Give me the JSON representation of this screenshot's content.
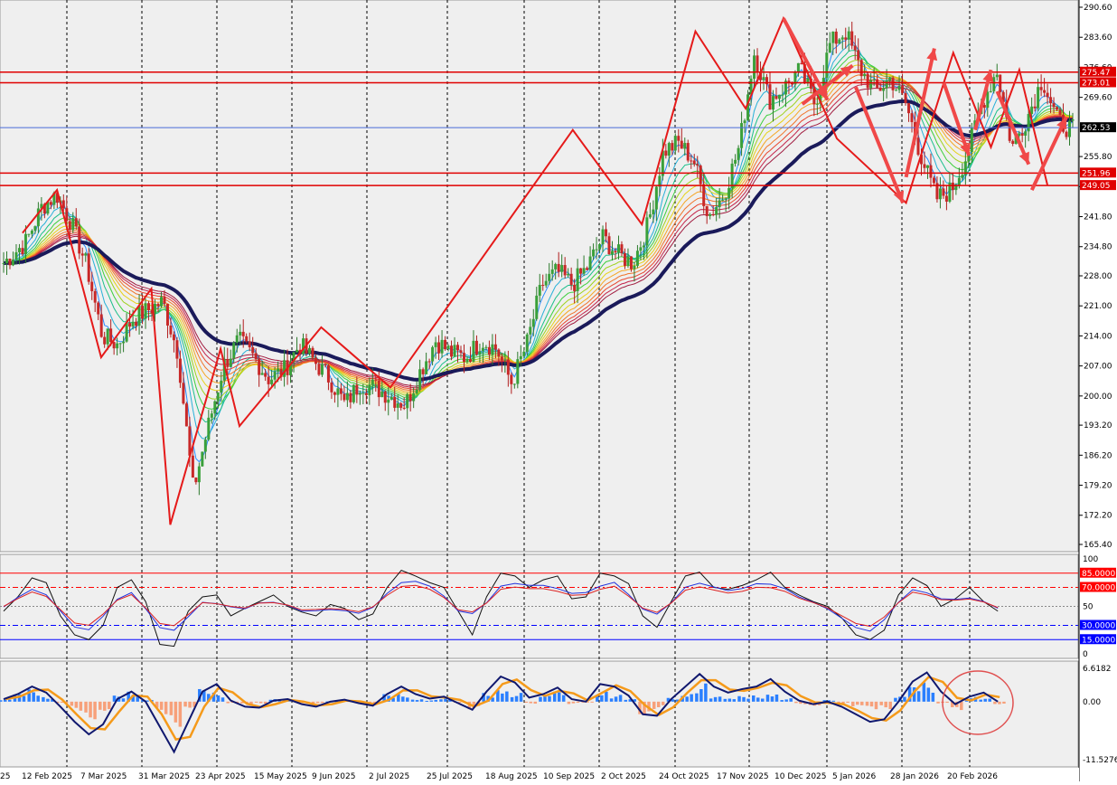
{
  "chart_data": [
    {
      "panel": "price",
      "type": "line",
      "title": "",
      "ylim": [
        165.4,
        290.6
      ],
      "y_ticks": [
        "290.60",
        "283.60",
        "276.60",
        "269.60",
        "262.53",
        "255.80",
        "248.80",
        "241.80",
        "234.80",
        "228.00",
        "221.00",
        "214.00",
        "207.00",
        "200.00",
        "193.20",
        "186.20",
        "179.20",
        "172.20",
        "165.40"
      ],
      "x_ticks": [
        "25",
        "12 Feb 2025",
        "7 Mar 2025",
        "31 Mar 2025",
        "23 Apr 2025",
        "15 May 2025",
        "9 Jun 2025",
        "2 Jul 2025",
        "25 Jul 2025",
        "18 Aug 2025",
        "10 Sep 2025",
        "2 Oct 2025",
        "24 Oct 2025",
        "17 Nov 2025",
        "10 Dec 2025",
        "5 Jan 2026",
        "28 Jan 2026",
        "20 Feb 2026"
      ],
      "current_price": "262.53",
      "horizontal_levels": [
        {
          "label": "275.47",
          "value": 275.47
        },
        {
          "label": "273.01",
          "value": 273.01
        },
        {
          "label": "251.96",
          "value": 251.96
        },
        {
          "label": "249.05",
          "value": 249.05
        }
      ],
      "close_series_index": [
        0,
        6,
        10,
        14,
        18,
        22,
        26,
        30,
        34,
        38,
        42,
        46,
        50,
        54,
        58,
        62,
        66,
        70,
        74,
        78,
        82,
        86,
        90,
        94,
        98,
        102,
        106,
        110,
        114,
        118,
        122,
        126,
        130,
        134,
        138,
        142,
        146,
        150,
        154,
        158,
        162,
        166,
        170,
        174,
        178,
        182,
        186,
        190,
        194,
        198,
        202,
        206,
        210,
        214,
        218,
        222,
        226,
        230,
        234,
        238,
        242,
        246,
        250,
        254,
        258,
        262,
        266,
        270,
        274,
        278,
        282
      ],
      "close_series_values": [
        231,
        236,
        244,
        247,
        240,
        230,
        214,
        212,
        218,
        220,
        222,
        210,
        178,
        193,
        207,
        213,
        209,
        204,
        206,
        212,
        208,
        204,
        198,
        203,
        202,
        200,
        198,
        206,
        213,
        210,
        209,
        213,
        211,
        203,
        212,
        226,
        229,
        226,
        230,
        237,
        233,
        231,
        240,
        257,
        259,
        255,
        242,
        247,
        258,
        280,
        269,
        272,
        276,
        268,
        282,
        285,
        276,
        271,
        274,
        268,
        256,
        246,
        248,
        256,
        268,
        276,
        258,
        265,
        274,
        264,
        262
      ],
      "zigzag_pivots": [
        {
          "x": 6,
          "y": 238
        },
        {
          "x": 17,
          "y": 248
        },
        {
          "x": 31,
          "y": 209
        },
        {
          "x": 47,
          "y": 225
        },
        {
          "x": 53,
          "y": 170
        },
        {
          "x": 69,
          "y": 211
        },
        {
          "x": 75,
          "y": 193
        },
        {
          "x": 101,
          "y": 216
        },
        {
          "x": 123,
          "y": 202
        },
        {
          "x": 181,
          "y": 262
        },
        {
          "x": 203,
          "y": 240
        },
        {
          "x": 220,
          "y": 285
        },
        {
          "x": 236,
          "y": 267
        },
        {
          "x": 248,
          "y": 288
        },
        {
          "x": 265,
          "y": 260
        },
        {
          "x": 287,
          "y": 245
        },
        {
          "x": 302,
          "y": 280
        },
        {
          "x": 314,
          "y": 258
        },
        {
          "x": 323,
          "y": 276
        },
        {
          "x": 332,
          "y": 249
        }
      ],
      "forecast_arrows": [
        {
          "from": [
            248,
            288
          ],
          "to": [
            262,
            269
          ]
        },
        {
          "from": [
            254,
            268
          ],
          "to": [
            270,
            277
          ]
        },
        {
          "from": [
            271,
            272
          ],
          "to": [
            286,
            245
          ]
        },
        {
          "from": [
            287,
            251
          ],
          "to": [
            296,
            281
          ]
        },
        {
          "from": [
            299,
            273
          ],
          "to": [
            307,
            256
          ]
        },
        {
          "from": [
            309,
            262
          ],
          "to": [
            314,
            276
          ]
        },
        {
          "from": [
            316,
            271
          ],
          "to": [
            326,
            254
          ]
        },
        {
          "from": [
            327,
            248
          ],
          "to": [
            338,
            265
          ]
        }
      ]
    },
    {
      "panel": "stochastic",
      "type": "line",
      "ylim": [
        0,
        100
      ],
      "y_ticks": [
        "100",
        "50",
        "0"
      ],
      "levels": [
        {
          "label": "85.0000",
          "value": 85,
          "color": "#ff0000"
        },
        {
          "label": "70.0000",
          "value": 70,
          "color": "#ff0000"
        },
        {
          "label": "30.0000",
          "value": 30,
          "color": "#0000ff"
        },
        {
          "label": "15.0000",
          "value": 15,
          "color": "#0000ff"
        }
      ],
      "k_values": [
        45,
        60,
        80,
        75,
        40,
        20,
        15,
        30,
        70,
        78,
        55,
        10,
        8,
        45,
        60,
        62,
        40,
        48,
        55,
        62,
        50,
        44,
        40,
        52,
        48,
        36,
        42,
        70,
        88,
        82,
        75,
        70,
        45,
        20,
        60,
        85,
        82,
        70,
        78,
        82,
        58,
        60,
        85,
        82,
        74,
        40,
        28,
        55,
        82,
        86,
        70,
        68,
        72,
        78,
        86,
        70,
        62,
        55,
        50,
        38,
        20,
        15,
        25,
        62,
        80,
        72,
        50,
        58,
        70,
        55,
        45
      ]
    },
    {
      "panel": "macd",
      "type": "bar",
      "ylim": [
        -11.5276,
        6.6182
      ],
      "y_ticks": [
        "6.6182",
        "0.00",
        "-11.5276"
      ],
      "histogram": [
        0.4,
        1.5,
        2.5,
        1.2,
        -0.5,
        -2.0,
        -3.5,
        -1.8,
        1.2,
        2.4,
        0.6,
        -3.0,
        -5.0,
        -1.2,
        2.5,
        2.0,
        -0.5,
        -0.8,
        -0.4,
        0.5,
        0.2,
        -0.4,
        -0.6,
        0.1,
        0.3,
        -0.1,
        -0.6,
        1.5,
        2.0,
        0.8,
        0.4,
        0.8,
        -0.2,
        -1.5,
        2.0,
        4.0,
        2.2,
        -0.4,
        1.2,
        2.0,
        -0.5,
        -0.2,
        2.8,
        1.4,
        0.5,
        -2.6,
        -1.5,
        1.0,
        2.4,
        4.0,
        1.0,
        0.6,
        1.1,
        1.5,
        2.6,
        0.8,
        -0.5,
        -0.8,
        0.3,
        -0.5,
        -1.5,
        -2.0,
        -1.5,
        1.0,
        3.0,
        4.0,
        -0.5,
        -2.5,
        1.0,
        0.6,
        -0.5
      ],
      "macd_values": [
        0.5,
        1.5,
        3.0,
        1.8,
        -1.0,
        -4.0,
        -6.5,
        -4.5,
        0.5,
        2.0,
        0.0,
        -5.0,
        -10.0,
        -4.0,
        2.0,
        3.5,
        0.2,
        -1.0,
        -1.2,
        0.2,
        0.5,
        -0.5,
        -1.0,
        0.0,
        0.4,
        -0.3,
        -0.8,
        1.5,
        3.0,
        1.5,
        0.6,
        1.0,
        -0.3,
        -1.6,
        2.0,
        5.0,
        3.8,
        0.8,
        1.5,
        2.8,
        0.5,
        0.0,
        3.5,
        3.0,
        1.2,
        -2.5,
        -2.8,
        0.5,
        3.0,
        5.5,
        3.0,
        1.8,
        2.5,
        3.0,
        4.5,
        2.0,
        0.2,
        -0.5,
        0.0,
        -1.0,
        -2.5,
        -4.0,
        -3.5,
        0.0,
        4.0,
        5.8,
        2.0,
        -0.5,
        1.0,
        1.8,
        0.0
      ]
    }
  ]
}
